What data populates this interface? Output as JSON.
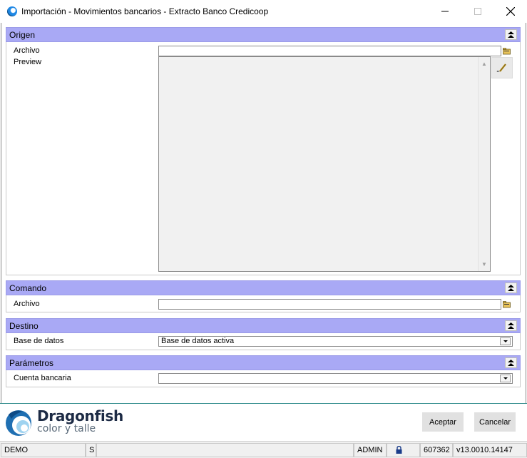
{
  "window": {
    "title": "Importación - Movimientos bancarios - Extracto Banco Credicoop",
    "minimize": "—",
    "maximize": "☐",
    "close": "✕"
  },
  "sections": {
    "origen": {
      "title": "Origen",
      "archivo_label": "Archivo",
      "archivo_value": "",
      "preview_label": "Preview",
      "preview_value": ""
    },
    "comando": {
      "title": "Comando",
      "archivo_label": "Archivo",
      "archivo_value": ""
    },
    "destino": {
      "title": "Destino",
      "base_label": "Base de datos",
      "base_value": "Base de datos activa"
    },
    "parametros": {
      "title": "Parámetros",
      "cuenta_label": "Cuenta bancaria",
      "cuenta_value": ""
    }
  },
  "footer": {
    "logo_name": "Dragonfish",
    "logo_tagline": "color y talle",
    "accept_label": "Aceptar",
    "cancel_label": "Cancelar"
  },
  "status": {
    "environment": "DEMO",
    "mode": "S",
    "user": "ADMIN",
    "serial": "607362",
    "version": "v13.0010.14147"
  },
  "colors": {
    "section_header": "#a9a9f5",
    "footer_line": "#2e8b8b"
  }
}
